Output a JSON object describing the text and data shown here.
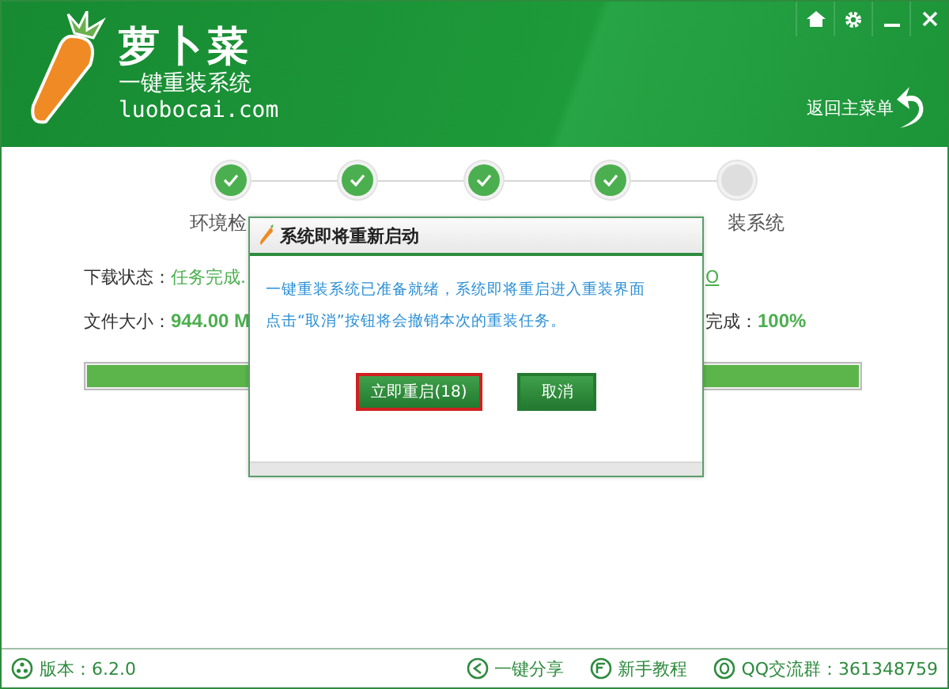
{
  "header": {
    "logo_title": "萝卜菜",
    "logo_subtitle": "一键重装系统",
    "logo_url": "luobocai.com",
    "back_label": "返回主菜单"
  },
  "steps": [
    {
      "label": "环境检",
      "done": true
    },
    {
      "done": true
    },
    {
      "done": true
    },
    {
      "done": true
    },
    {
      "label": "装系统",
      "done": false
    }
  ],
  "status": {
    "state_label": "下载状态：",
    "state_value": "任务完成.",
    "link": "O",
    "size_label": "文件大小：",
    "size_value": "944.00 M",
    "done_label": "完成：",
    "done_value": "100%",
    "progress": {
      "level": 1
    }
  },
  "dialog": {
    "title": "系统即将重新启动",
    "message": [
      "一键重装系统已准备就绪，系统即将重启进入重装界面",
      "点击“取消”按钮将会撤销本次的重装任务。"
    ],
    "buttons": [
      {
        "label": "立即重启(18)",
        "selected": true
      },
      {
        "label": "取消",
        "selected": false
      }
    ]
  },
  "footer": {
    "version": "版本：6.2.0",
    "share": "一键分享",
    "tutorial": "新手教程",
    "qq": "QQ交流群：361348759"
  }
}
